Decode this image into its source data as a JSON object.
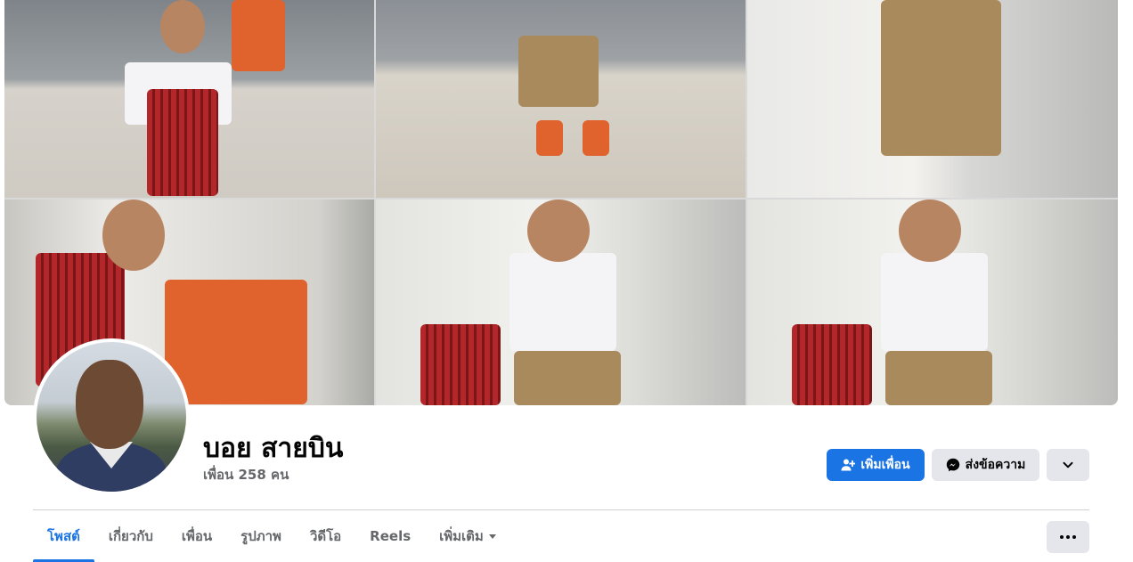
{
  "profile": {
    "name": "บอย สายบิน",
    "friend_count": "เพื่อน 258 คน"
  },
  "actions": {
    "add_friend_label": "เพิ่มเพื่อน",
    "message_label": "ส่งข้อความ",
    "add_friend_icon": "person-add-icon",
    "message_icon": "messenger-icon",
    "more_icon": "chevron-down-icon"
  },
  "tabs": [
    {
      "label": "โพสต์",
      "active": true
    },
    {
      "label": "เกี่ยวกับ"
    },
    {
      "label": "เพื่อน"
    },
    {
      "label": "รูปภาพ"
    },
    {
      "label": "วิดีโอ"
    },
    {
      "label": "Reels"
    },
    {
      "label": "เพิ่มเติม",
      "dropdown": true
    }
  ],
  "colors": {
    "accent": "#1b74e4",
    "secondary_button": "#e4e6eb",
    "muted_text": "#65676b"
  }
}
